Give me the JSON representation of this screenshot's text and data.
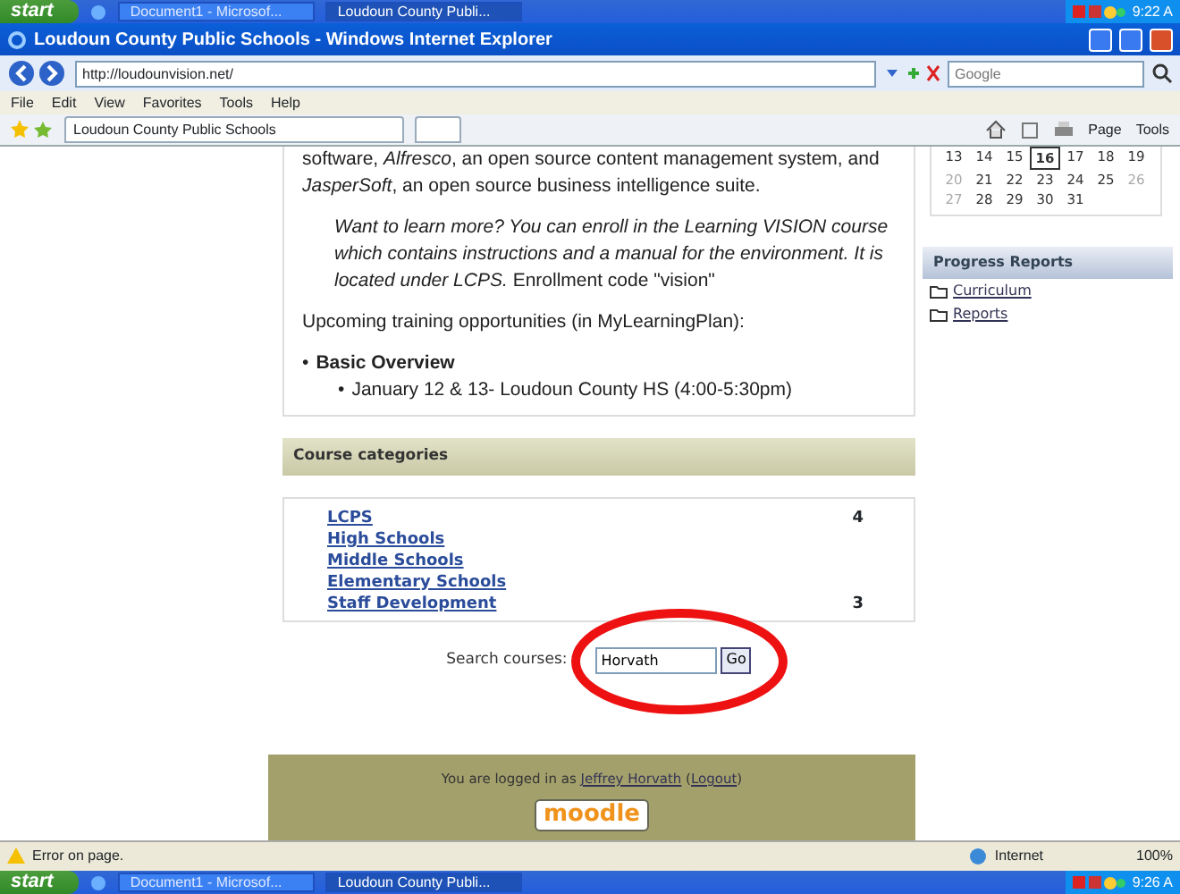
{
  "taskbar_top": {
    "start": "start",
    "tasks": [
      {
        "label": "Document1 - Microsof...",
        "selected": false
      },
      {
        "label": "Loudoun County Publi...",
        "selected": true
      }
    ],
    "clock": "9:22 A"
  },
  "window": {
    "title": "Loudoun County Public Schools - Windows Internet Explorer"
  },
  "address_bar": {
    "value": "http://loudounvision.net/"
  },
  "search_box": {
    "placeholder": "Google"
  },
  "menu": [
    "File",
    "Edit",
    "View",
    "Favorites",
    "Tools",
    "Help"
  ],
  "tabs": [
    {
      "label": "Loudoun County Public Schools",
      "selected": true
    }
  ],
  "toolbar": [
    "Page",
    "Tools"
  ],
  "main": {
    "intro": "software, *Alfresco*, an open source content management system, and *JasperSoft*, an open source business intelligence suite.",
    "quote": "*Want to learn more? You can enroll in the Learning VISION course which contains instructions and a manual for the environment. It is located under LCPS.* Enrollment code \"vision\"",
    "upcoming": "Upcoming training opportunities (in MyLearningPlan):",
    "list": [
      {
        "marker": "•",
        "text": "Basic Overview",
        "children": [
          {
            "marker": "•",
            "text": "January 12 & 13- Loudoun County HS (4:00-5:30pm)"
          }
        ]
      }
    ]
  },
  "course_categories": {
    "title": "Course categories",
    "items": [
      {
        "name": "LCPS",
        "count": "4"
      },
      {
        "name": "High Schools"
      },
      {
        "name": "Middle Schools"
      },
      {
        "name": "Elementary Schools"
      },
      {
        "name": "Staff Development",
        "count": "3"
      }
    ]
  },
  "course_search": {
    "label": "Search courses:",
    "value": "Horvath",
    "button": "Go"
  },
  "footer": {
    "login_prefix": "You are logged in as",
    "user": "Jeffrey Horvath",
    "paren_open": "(",
    "logout": "Logout",
    "paren_close": ")",
    "logo": "moodle"
  },
  "calendar": {
    "weeks": [
      [
        {
          "day": "13",
          "weekend": false,
          "today": false
        },
        {
          "day": "14",
          "weekend": false,
          "today": false
        },
        {
          "day": "15",
          "weekend": false,
          "today": false
        },
        {
          "day": "16",
          "weekend": false,
          "today": true
        },
        {
          "day": "17",
          "weekend": false,
          "today": false
        },
        {
          "day": "18",
          "weekend": false,
          "today": false
        },
        {
          "day": "19",
          "weekend": false,
          "today": false
        }
      ],
      [
        {
          "day": "20",
          "weekend": true,
          "today": false
        },
        {
          "day": "21",
          "weekend": false,
          "today": false
        },
        {
          "day": "22",
          "weekend": false,
          "today": false
        },
        {
          "day": "23",
          "weekend": false,
          "today": false
        },
        {
          "day": "24",
          "weekend": false,
          "today": false
        },
        {
          "day": "25",
          "weekend": false,
          "today": false
        },
        {
          "day": "26",
          "weekend": true,
          "today": false
        }
      ],
      [
        {
          "day": "27",
          "weekend": true,
          "today": false
        },
        {
          "day": "28",
          "weekend": false,
          "today": false
        },
        {
          "day": "29",
          "weekend": false,
          "today": false
        },
        {
          "day": "30",
          "weekend": false,
          "today": false
        },
        {
          "day": "31",
          "weekend": false,
          "today": false
        }
      ]
    ]
  },
  "progress_reports": {
    "title": "Progress Reports",
    "items": [
      "Curriculum",
      "Reports"
    ]
  },
  "status_bar": {
    "message": "Error on page.",
    "zone": "Internet",
    "zoom": "100%"
  },
  "taskbar_bottom": {
    "start": "start",
    "tasks": [
      {
        "label": "Document1 - Microsof...",
        "selected": false
      },
      {
        "label": "Loudoun County Publi...",
        "selected": true
      }
    ],
    "clock": "9:26 A"
  },
  "annotation": {
    "color": "#ee1111"
  }
}
